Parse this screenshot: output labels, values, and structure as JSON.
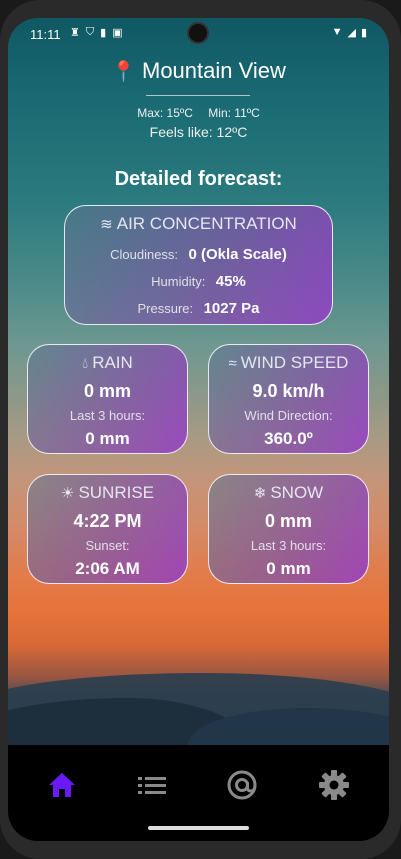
{
  "status_bar": {
    "time": "11:11"
  },
  "header": {
    "city": "Mountain View",
    "max_label": "Max: 15ºC",
    "min_label": "Min: 11ºC",
    "feels_like": "Feels like: 12ºC"
  },
  "forecast_title": "Detailed forecast:",
  "air": {
    "title": "AIR CONCENTRATION",
    "cloudiness_label": "Cloudiness:",
    "cloudiness_value": "0 (Okla Scale)",
    "humidity_label": "Humidity:",
    "humidity_value": "45%",
    "pressure_label": "Pressure:",
    "pressure_value": "1027 Pa"
  },
  "rain": {
    "title": "RAIN",
    "value": "0 mm",
    "sub_label": "Last 3 hours:",
    "sub_value": "0 mm"
  },
  "wind": {
    "title": "WIND SPEED",
    "value": "9.0 km/h",
    "sub_label": "Wind Direction:",
    "sub_value": "360.0º"
  },
  "sunrise": {
    "title": "SUNRISE",
    "value": "4:22 PM",
    "sub_label": "Sunset:",
    "sub_value": "2:06 AM"
  },
  "snow": {
    "title": "SNOW",
    "value": "0 mm",
    "sub_label": "Last 3 hours:",
    "sub_value": "0 mm"
  },
  "nav": {
    "active_color": "#6a1bf5",
    "inactive_color": "#8a8a8a",
    "items": [
      "home-icon",
      "list-icon",
      "at-sign-icon",
      "gear-icon"
    ]
  }
}
